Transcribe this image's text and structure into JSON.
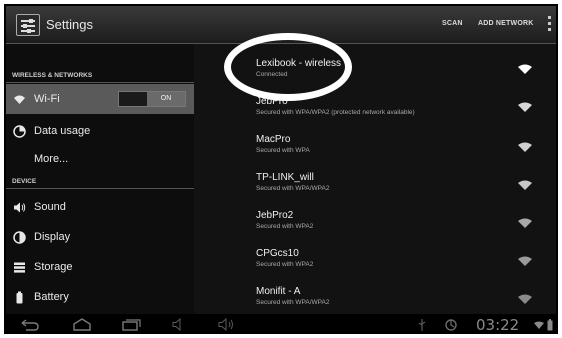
{
  "header": {
    "title": "Settings",
    "actions": {
      "scan": "SCAN",
      "add_network": "ADD NETWORK"
    },
    "overflow_icon": "more-vertical-icon"
  },
  "sidebar": {
    "sections": [
      {
        "label": "WIRELESS & NETWORKS"
      },
      {
        "label": "DEVICE"
      }
    ],
    "items": [
      {
        "label": "Wi-Fi",
        "icon": "wifi-icon",
        "selected": true
      },
      {
        "label": "Data usage",
        "icon": "data-usage-icon"
      },
      {
        "label": "More..."
      },
      {
        "label": "Sound",
        "icon": "speaker-icon"
      },
      {
        "label": "Display",
        "icon": "brightness-icon"
      },
      {
        "label": "Storage",
        "icon": "storage-icon"
      },
      {
        "label": "Battery",
        "icon": "battery-icon"
      }
    ],
    "wifi_toggle": {
      "state": "ON"
    }
  },
  "networks": [
    {
      "name": "Lexibook - wireless",
      "status": "Connected"
    },
    {
      "name": "JebPro",
      "status": "Secured with WPA/WPA2 (protected network available)"
    },
    {
      "name": "MacPro",
      "status": "Secured with WPA"
    },
    {
      "name": "TP-LINK_will",
      "status": "Secured with WPA/WPA2"
    },
    {
      "name": "JebPro2",
      "status": "Secured with WPA2"
    },
    {
      "name": "CPGcs10",
      "status": "Secured with WPA2"
    },
    {
      "name": "Monifit - A",
      "status": "Secured with WPA/WPA2"
    }
  ],
  "system_bar": {
    "time": "03:22",
    "icons": [
      "back-icon",
      "home-icon",
      "recent-apps-icon",
      "volume-down-icon",
      "volume-up-icon",
      "usb-icon",
      "sync-icon",
      "wifi-status-icon",
      "battery-status-icon"
    ]
  },
  "colors": {
    "background": "#111111",
    "selected_item": "#5a5a5a",
    "callout": "#ffffff"
  }
}
